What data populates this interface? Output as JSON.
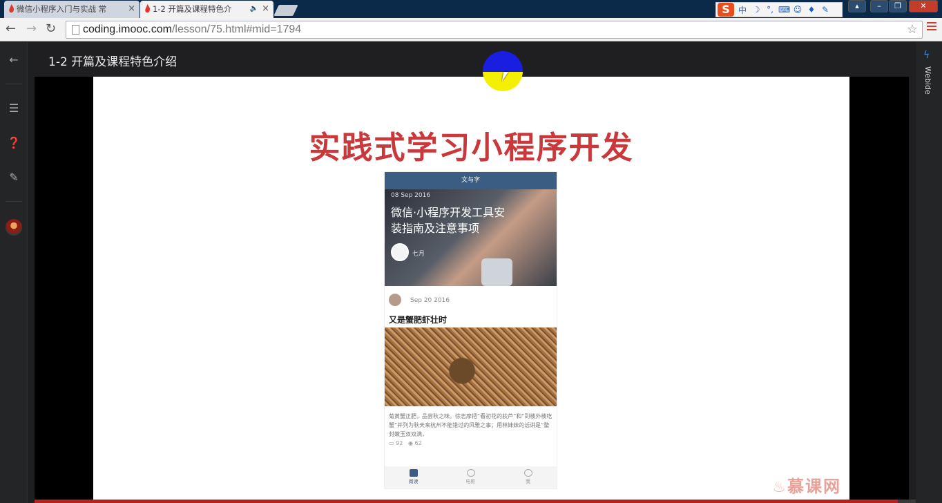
{
  "browser": {
    "tabs": [
      {
        "label": "微信小程序入门与实战 常",
        "close": "×"
      },
      {
        "label": "1-2 开篇及课程特色介",
        "close": "×"
      }
    ],
    "url_host": "coding.imooc.com",
    "url_path": "/lesson/75.html#mid=1794",
    "ime": {
      "logo": "S",
      "lang": "中"
    }
  },
  "page": {
    "lesson_title": "1-2 开篇及课程特色介绍",
    "right_panel_label": "Webide",
    "progress": 0.98
  },
  "slide": {
    "title": "实践式学习小程序开发",
    "phone": {
      "app_title": "文与字",
      "hero_date": "08 Sep 2016",
      "hero_title": "微信·小程序开发工具安装指南及注意事项",
      "hero_author": "七月",
      "post_date": "Sep 20 2016",
      "post_title": "又是蟹肥虾壮时",
      "post_body": "菊黄蟹正肥，品尝秋之味。徐志摩把“看初花的荻芦”和“到楼外楼吃蟹”并列为秋天来杭州不能错过的风雅之事；用林妹妹的话讲是“螯封嫩玉双双满，",
      "comments": "92",
      "views": "62",
      "tabs": [
        "阅读",
        "电影",
        "我"
      ]
    },
    "brand": "慕课网"
  }
}
